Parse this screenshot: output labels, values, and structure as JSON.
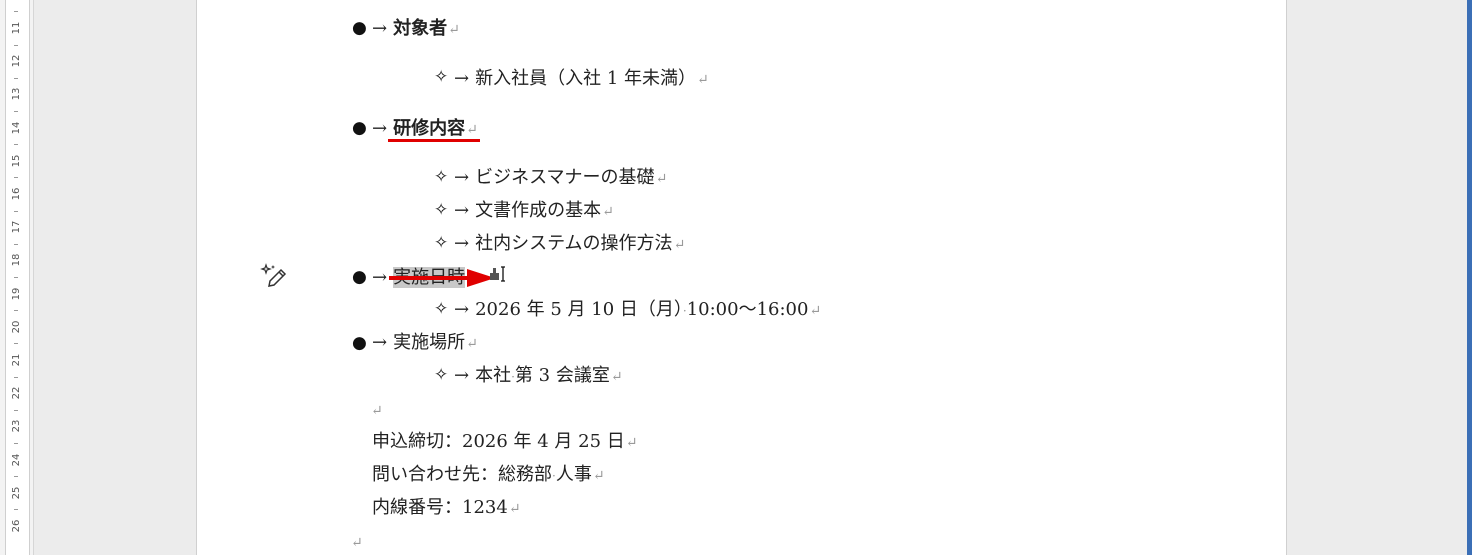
{
  "ruler": {
    "numbers": [
      "11",
      "12",
      "13",
      "14",
      "15",
      "16",
      "17",
      "18",
      "19",
      "20",
      "21",
      "22",
      "23",
      "24",
      "25",
      "26"
    ]
  },
  "doc": {
    "target": {
      "bullet": "●",
      "arrow": "→",
      "title": "対象者",
      "mark": "↵"
    },
    "target_item": {
      "bullet": "✧",
      "arrow": "→",
      "text": "新入社員（入社 1 年未満）",
      "mark": "↵"
    },
    "content": {
      "bullet": "●",
      "arrow": "→",
      "title": "研修内容",
      "mark": "↵"
    },
    "content_items": [
      {
        "bullet": "✧",
        "arrow": "→",
        "text": "ビジネスマナーの基礎",
        "mark": "↵"
      },
      {
        "bullet": "✧",
        "arrow": "→",
        "text": "文書作成の基本",
        "mark": "↵"
      },
      {
        "bullet": "✧",
        "arrow": "→",
        "text": "社内システムの操作方法",
        "mark": "↵"
      }
    ],
    "date": {
      "bullet": "●",
      "arrow": "→",
      "title": "実施日時",
      "mark": "↵"
    },
    "date_item": {
      "bullet": "✧",
      "arrow": "→",
      "text_a": "2026 年 5 月 10 日（月）",
      "dot": "·",
      "text_b": "10:00～16:00",
      "mark": "↵"
    },
    "place": {
      "bullet": "●",
      "arrow": "→",
      "title": "実施場所",
      "mark": "↵"
    },
    "place_item": {
      "bullet": "✧",
      "arrow": "→",
      "text_a": "本社",
      "dot": "·",
      "text_b": "第 3 会議室",
      "mark": "↵"
    },
    "empty_mark": "↵",
    "deadline": {
      "text": "申込締切：2026 年 4 月 25 日",
      "mark": "↵"
    },
    "contact": {
      "text_a": "問い合わせ先：総務部",
      "dot": "·",
      "text_b": "人事",
      "mark": "↵"
    },
    "ext": {
      "text": "内線番号：1234",
      "mark": "↵"
    },
    "end_mark": "↵"
  },
  "colors": {
    "annotation_red": "#e00000",
    "selection_gray": "#c8c8c8",
    "scroll_blue": "#3b6fb6"
  },
  "icons": {
    "sparkle": "sparkle-pen-icon",
    "cursor": "format-painter-cursor-icon"
  }
}
